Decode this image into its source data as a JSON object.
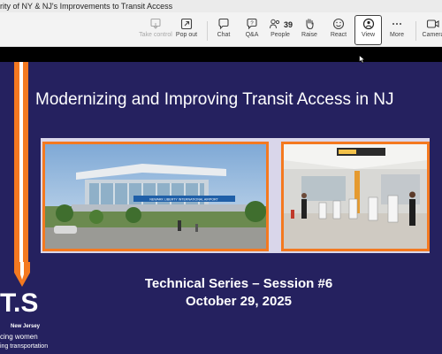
{
  "window": {
    "title": "rity of NY & NJ's Improvements to Transit Access"
  },
  "toolbar": {
    "take_control": "Take control",
    "pop_out": "Pop out",
    "chat": "Chat",
    "qa": "Q&A",
    "people_count": "39",
    "people": "People",
    "raise": "Raise",
    "react": "React",
    "view": "View",
    "more": "More",
    "camera": "Camera"
  },
  "slide": {
    "title": "Modernizing and Improving Transit Access in NJ",
    "subtitle_line1": "Technical Series – Session #6",
    "subtitle_line2": "October 29, 2025",
    "logo_mark": "T.S",
    "logo_line1": "New Jersey",
    "logo_line2": "cing women",
    "logo_line3": "ing transportation",
    "station_sign": "NEWARK LIBERTY INTERNATIONAL AIRPORT",
    "colors": {
      "background": "#25215f",
      "accent": "#f47920"
    }
  }
}
